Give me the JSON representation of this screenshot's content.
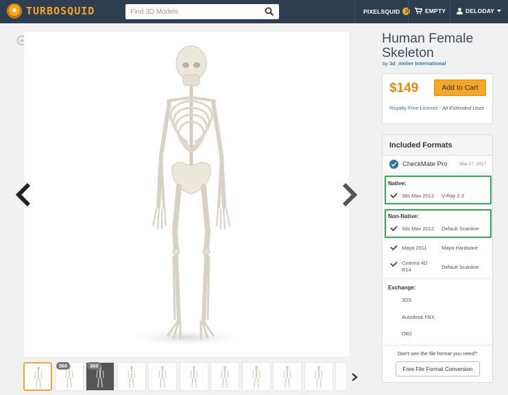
{
  "header": {
    "logo_text": "TURBOSQUID",
    "search_placeholder": "Find 3D Models",
    "pixelsquid_label": "PIXELSQUID",
    "cart_label": "EMPTY",
    "user_label": "DELODAY",
    "brand_color": "#2d3e50",
    "accent_color": "#f5a623"
  },
  "viewer": {
    "thumbnails": [
      {
        "badge": "",
        "selected": true,
        "dark": false
      },
      {
        "badge": "360",
        "selected": false,
        "dark": false
      },
      {
        "badge": "360",
        "selected": false,
        "dark": true
      },
      {
        "badge": "",
        "selected": false,
        "dark": false
      },
      {
        "badge": "",
        "selected": false,
        "dark": false
      },
      {
        "badge": "",
        "selected": false,
        "dark": false
      },
      {
        "badge": "",
        "selected": false,
        "dark": false
      },
      {
        "badge": "",
        "selected": false,
        "dark": false
      },
      {
        "badge": "",
        "selected": false,
        "dark": false
      },
      {
        "badge": "",
        "selected": false,
        "dark": false
      },
      {
        "badge": "",
        "selected": false,
        "dark": false
      }
    ]
  },
  "product": {
    "title": "Human Female Skeleton",
    "by_prefix": "by",
    "author": "3d_molier International",
    "price": "$149",
    "add_to_cart": "Add to Cart",
    "license_link": "Royalty Free License",
    "license_suffix": "All Extended Uses"
  },
  "formats": {
    "heading": "Included Formats",
    "checkmate_label": "CheckMate Pro",
    "checkmate_date": "Mar 17, 2017",
    "native_title": "Native:",
    "native_rows": [
      {
        "app": "3ds Max 2012",
        "renderer": "V-Ray 2.3"
      }
    ],
    "non_native_title": "Non-Native:",
    "non_native_rows": [
      {
        "app": "3ds Max 2012",
        "renderer": "Default Scanline"
      },
      {
        "app": "Maya 2011",
        "renderer": "Maya Hardware"
      },
      {
        "app": "Cinema 4D R14",
        "renderer": "Default Scanline"
      }
    ],
    "exchange_title": "Exchange:",
    "exchange_items": [
      "3DS",
      "Autodesk FBX",
      "OBJ"
    ],
    "question": "Don't see the file format you need?",
    "conversion_button": "Free File Format Conversion",
    "highlight_color": "#2eae4d"
  }
}
